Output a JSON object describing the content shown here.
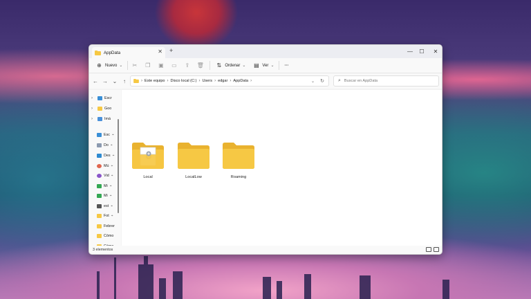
{
  "window": {
    "tab_title": "AppData",
    "tab_close_glyph": "✕",
    "new_tab_glyph": "+",
    "minimize_glyph": "—",
    "maximize_glyph": "☐",
    "close_glyph": "✕"
  },
  "toolbar": {
    "new_label": "Nuevo",
    "sort_label": "Ordenar",
    "view_label": "Ver",
    "more_glyph": "···"
  },
  "breadcrumb": [
    "Este equipo",
    "Disco local (C:)",
    "Users",
    "edgar",
    "AppData"
  ],
  "search": {
    "placeholder": "Buscar en AppData"
  },
  "sidebar": {
    "items": [
      {
        "label": "Escr",
        "icon": "desktop-icon",
        "expandable": true
      },
      {
        "label": "Goo",
        "icon": "folder-icon",
        "expandable": true
      },
      {
        "label": "Imá",
        "icon": "pictures-icon",
        "expandable": true
      },
      {
        "label": "Esc",
        "icon": "desktop-icon",
        "pinned": true
      },
      {
        "label": "Do",
        "icon": "documents-icon",
        "pinned": true
      },
      {
        "label": "Des",
        "icon": "downloads-icon",
        "pinned": true
      },
      {
        "label": "Mú",
        "icon": "music-icon",
        "pinned": true
      },
      {
        "label": "Vid",
        "icon": "videos-icon",
        "pinned": true
      },
      {
        "label": "Mi",
        "icon": "drive-icon",
        "pinned": true
      },
      {
        "label": "Mi",
        "icon": "drive-icon",
        "pinned": true
      },
      {
        "label": "est",
        "icon": "drive-bar-icon",
        "pinned": true
      },
      {
        "label": "Fot",
        "icon": "folder-icon",
        "pinned": true
      },
      {
        "label": "Febrer",
        "icon": "folder-icon"
      },
      {
        "label": "Cómo",
        "icon": "folder-icon"
      },
      {
        "label": "Cómo",
        "icon": "folder-icon"
      }
    ]
  },
  "folders": [
    {
      "name": "Local",
      "icon": "folder-with-file-icon"
    },
    {
      "name": "LocalLow",
      "icon": "folder-icon"
    },
    {
      "name": "Roaming",
      "icon": "folder-icon"
    }
  ],
  "status": {
    "item_count": "3 elementos"
  },
  "colors": {
    "folder": "#f6c844",
    "folder_dark": "#e9b22f",
    "window_bg": "#f3f3f3"
  }
}
